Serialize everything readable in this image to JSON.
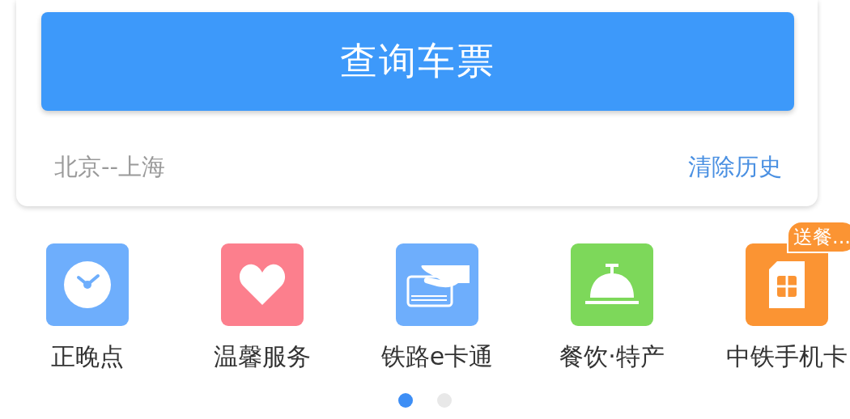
{
  "search_button": "查询车票",
  "history": {
    "route": "北京--上海",
    "clear": "清除历史"
  },
  "services": [
    {
      "label": "正晚点",
      "kind": "clock",
      "color": "#6eaefc"
    },
    {
      "label": "温馨服务",
      "kind": "heart",
      "color": "#fc7f8d"
    },
    {
      "label": "铁路e卡通",
      "kind": "card",
      "color": "#6eaefc"
    },
    {
      "label": "餐饮·特产",
      "kind": "bell",
      "color": "#7dd85a"
    },
    {
      "label": "中铁手机卡",
      "kind": "sim",
      "color": "#fb9433",
      "badge": "送餐..."
    }
  ],
  "pager": [
    {
      "selected": true
    },
    {
      "selected": false
    }
  ]
}
